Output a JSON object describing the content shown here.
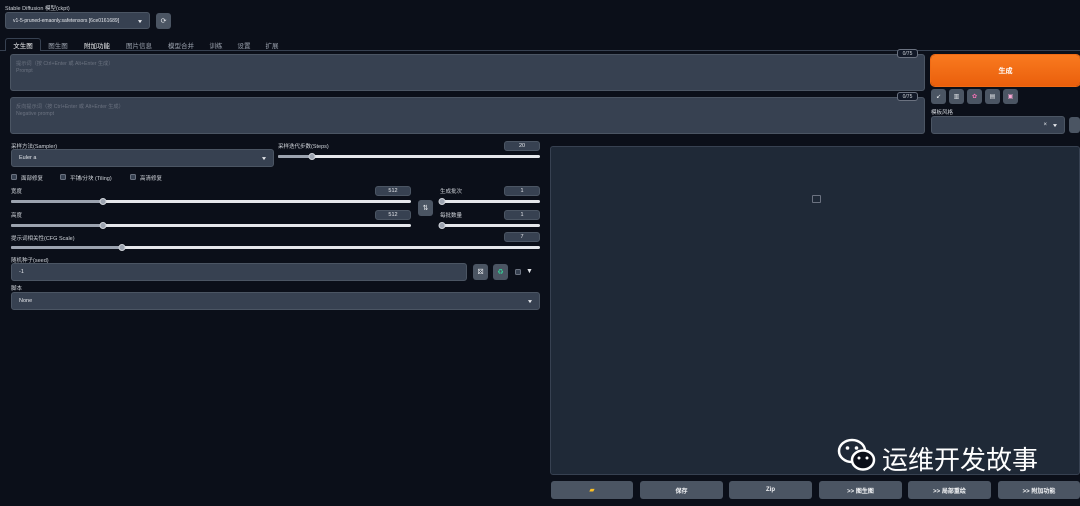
{
  "model": {
    "label": "Stable Diffusion 模型(ckpt)",
    "value": "v1-5-pruned-emaonly.safetensors [6ce0161689]"
  },
  "tabs": [
    "文生图",
    "图生图",
    "附加功能",
    "图片信息",
    "模型合并",
    "训练",
    "设置",
    "扩展"
  ],
  "prompt": {
    "placeholder_line1": "提示词（按 Ctrl+Enter 或 Alt+Enter 生成）",
    "placeholder_line2": "Prompt",
    "counter": "0/75"
  },
  "negative_prompt": {
    "placeholder_line1": "反向提示词（按 Ctrl+Enter 或 Alt+Enter 生成）",
    "placeholder_line2": "Negative prompt",
    "counter": "0/75"
  },
  "generate": {
    "label": "生成",
    "color": "#f06a14"
  },
  "style": {
    "label": "模板风格"
  },
  "sampler": {
    "label": "采样方法(Sampler)",
    "value": "Euler a"
  },
  "steps": {
    "label": "采样迭代步数(Steps)",
    "value": "20",
    "fraction": 0.13
  },
  "options": {
    "restore_faces": "面部修复",
    "tiling": "平铺/分块 (Tiling)",
    "hires_fix": "高清修复"
  },
  "width": {
    "label": "宽度",
    "value": "512",
    "fraction": 0.23
  },
  "height": {
    "label": "高度",
    "value": "512",
    "fraction": 0.23
  },
  "batch_count": {
    "label": "生成批次",
    "value": "1",
    "fraction": 0.0
  },
  "batch_size": {
    "label": "每批数量",
    "value": "1",
    "fraction": 0.0
  },
  "cfg": {
    "label": "提示词相关性(CFG Scale)",
    "value": "7",
    "fraction": 0.21
  },
  "seed": {
    "label": "随机种子(seed)",
    "value": "-1"
  },
  "script": {
    "label": "脚本",
    "value": "None"
  },
  "output_buttons": {
    "save": "保存",
    "zip": "Zip",
    "to_img2img": ">> 图生图",
    "to_inpaint": ">> 局部重绘",
    "to_extras": ">> 附加功能"
  },
  "watermark": {
    "text": "运维开发故事"
  }
}
